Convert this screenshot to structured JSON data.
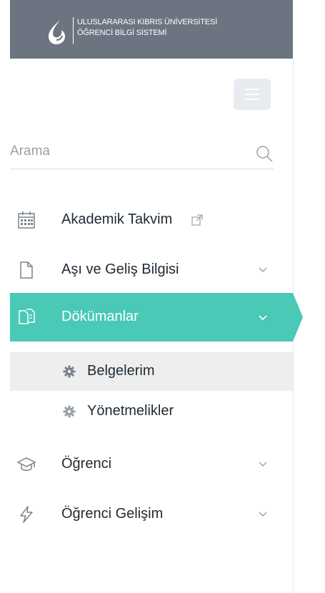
{
  "brand": {
    "line1": "ULUSLARARASI KIBRIS ÜNİVERSİTESİ",
    "line2": "ÖĞRENCİ BİLGİ SİSTEMİ"
  },
  "search": {
    "placeholder": "Arama",
    "icon": "search-icon"
  },
  "menu": {
    "items": [
      {
        "label": "Akademik Takvim",
        "icon": "calendar-icon",
        "external": true
      },
      {
        "label": "Aşı ve Geliş Bilgisi",
        "icon": "document-icon",
        "expandable": true
      },
      {
        "label": "Dökümanlar",
        "icon": "documents-icon",
        "expandable": true,
        "active": true
      },
      {
        "label": "Öğrenci",
        "icon": "graduation-cap-icon",
        "expandable": true
      },
      {
        "label": "Öğrenci Gelişim",
        "icon": "lightning-icon",
        "expandable": true
      }
    ],
    "submenu": [
      {
        "label": "Belgelerim",
        "icon": "gear-icon",
        "selected": true
      },
      {
        "label": "Yönetmelikler",
        "icon": "gear-icon",
        "selected": false
      }
    ]
  },
  "colors": {
    "header_bg": "#6b7480",
    "active_bg": "#4ac9b6",
    "selected_bg": "#eeeeee",
    "text": "#1f2a33",
    "icon": "#7b828b"
  }
}
